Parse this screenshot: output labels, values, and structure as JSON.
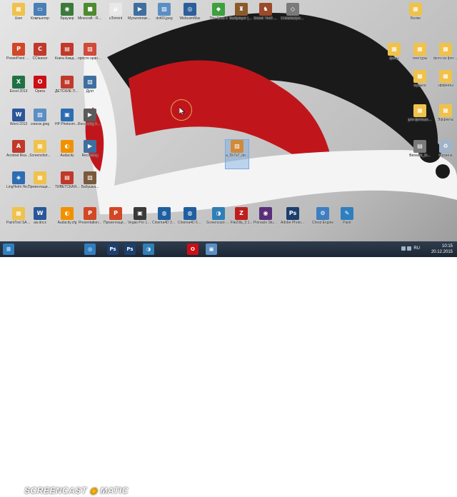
{
  "desktop": {
    "icons": [
      {
        "label": "User",
        "icon": "user-folder-icon",
        "color": "#f0c24b",
        "glyph": "▦"
      },
      {
        "label": "Компьютер",
        "icon": "computer-icon",
        "color": "#4a7fb5",
        "glyph": "▭"
      },
      {
        "label": "Браузер",
        "icon": "browser-icon",
        "color": "#3b7a3b",
        "glyph": "◉"
      },
      {
        "label": "Minecraft - Ru-M.org",
        "icon": "minecraft-icon",
        "color": "#4e8a2f",
        "glyph": "■"
      },
      {
        "label": "uTorrent",
        "icon": "utorrent-icon",
        "color": "#e8e8e8",
        "glyph": "µ"
      },
      {
        "label": "Мультипликация...",
        "icon": "video-file-icon",
        "color": "#3f6fa0",
        "glyph": "▶"
      },
      {
        "label": "dot69.jpeg",
        "icon": "image-file-icon",
        "color": "#5b8fc4",
        "glyph": "▨"
      },
      {
        "label": "WebcamMax",
        "icon": "webcam-icon",
        "color": "#2d5f9a",
        "glyph": "◎"
      },
      {
        "label": "The Sims 4",
        "icon": "sims-icon",
        "color": "#3ea03e",
        "glyph": "◆"
      },
      {
        "label": "Multiplayer [0.3e]",
        "icon": "game-icon",
        "color": "#8b5a2b",
        "glyph": "♜"
      },
      {
        "label": "Grand Theft Auto San ...",
        "icon": "gta-icon",
        "color": "#9a4a2a",
        "glyph": "♞"
      },
      {
        "label": "CristaliaUpdater.exe",
        "icon": "exe-icon",
        "color": "#7a7a7a",
        "glyph": "◇"
      },
      {
        "label": "PowerPoint 2013",
        "icon": "powerpoint-icon",
        "color": "#d24726",
        "glyph": "P"
      },
      {
        "label": "CCleaner",
        "icon": "ccleaner-icon",
        "color": "#c0392b",
        "glyph": "C"
      },
      {
        "label": "Книга Каждый ж...",
        "icon": "pdf-file-icon",
        "color": "#c0392b",
        "glyph": "▤"
      },
      {
        "label": "просто хранится_...",
        "icon": "image-file-icon",
        "color": "#d04a3a",
        "glyph": "▨"
      },
      {
        "label": "Excel 2013",
        "icon": "excel-icon",
        "color": "#1f7244",
        "glyph": "X"
      },
      {
        "label": "Opera",
        "icon": "opera-icon",
        "color": "#cc0f16",
        "glyph": "O"
      },
      {
        "label": "ДЕТСКИЕ ЛИТЕРАТ...",
        "icon": "document-icon",
        "color": "#c0392b",
        "glyph": "▤"
      },
      {
        "label": "Дуэт",
        "icon": "image-file-icon",
        "color": "#3f6fa0",
        "glyph": "▨"
      },
      {
        "label": "Word 2013",
        "icon": "word-icon",
        "color": "#2b579a",
        "glyph": "W"
      },
      {
        "label": "список.jpeg",
        "icon": "image-file-icon",
        "color": "#5b8fc4",
        "glyph": "▨"
      },
      {
        "label": "HP Photosma...",
        "icon": "hp-photosmart-icon",
        "color": "#2d6db3",
        "glyph": "▣"
      },
      {
        "label": "Recording #21.mp4",
        "icon": "video-file-icon",
        "color": "#5a5a5a",
        "glyph": "▶"
      },
      {
        "label": "Acrobat Reader DC",
        "icon": "acrobat-icon",
        "color": "#c0392b",
        "glyph": "A"
      },
      {
        "label": "Screenshot...",
        "icon": "folder-icon",
        "color": "#f0c24b",
        "glyph": "▦"
      },
      {
        "label": "Audacity",
        "icon": "audacity-icon",
        "color": "#f29100",
        "glyph": "◐"
      },
      {
        "label": "Recording",
        "icon": "video-file-icon",
        "color": "#3f6fa0",
        "glyph": "▶"
      },
      {
        "label": "LingHelm Heriachi",
        "icon": "app-icon",
        "color": "#2d6db3",
        "glyph": "◈"
      },
      {
        "label": "Презентации...",
        "icon": "folder-icon",
        "color": "#f0c24b",
        "glyph": "▦"
      },
      {
        "label": "ТИВЕТСКАЯ...",
        "icon": "document-icon",
        "color": "#c0392b",
        "glyph": "▤"
      },
      {
        "label": "Бабушка...",
        "icon": "image-file-icon",
        "color": "#7a5a3a",
        "glyph": "▨"
      },
      {
        "label": "PaintTool SAI Ru-san Pack",
        "icon": "painttool-icon",
        "color": "#f0c24b",
        "glyph": "▦"
      },
      {
        "label": "aw.docx",
        "icon": "word-doc-icon",
        "color": "#2b579a",
        "glyph": "W"
      },
      {
        "label": "Audacity.cfg",
        "icon": "audacity-icon",
        "color": "#f29100",
        "glyph": "◐"
      },
      {
        "label": "Presentation...",
        "icon": "powerpoint-doc-icon",
        "color": "#d24726",
        "glyph": "P"
      },
      {
        "label": "Презентация...",
        "icon": "powerpoint-doc-icon",
        "color": "#d24726",
        "glyph": "P"
      },
      {
        "label": "Vegas Pro 13.0 (64-bit)",
        "icon": "vegas-icon",
        "color": "#3a3a3a",
        "glyph": "▣"
      },
      {
        "label": "Cinema4D 32bit",
        "icon": "cinema4d-icon",
        "color": "#1f5fa0",
        "glyph": "◍"
      },
      {
        "label": "Cinema4D 64bit",
        "icon": "cinema4d-icon",
        "color": "#1f5fa0",
        "glyph": "◍"
      },
      {
        "label": "Screencast-O-Matic 2",
        "icon": "screencast-icon",
        "color": "#2f7fb8",
        "glyph": "◑"
      },
      {
        "label": "FileZilla_3.1...",
        "icon": "filezilla-icon",
        "color": "#bf1e1e",
        "glyph": "Z"
      },
      {
        "label": "Pinnacle Studio 16",
        "icon": "pinnacle-icon",
        "color": "#5a2f7a",
        "glyph": "◉"
      },
      {
        "label": "Adobe Photosh...",
        "icon": "photoshop-icon",
        "color": "#1b3f6e",
        "glyph": "Ps"
      },
      {
        "label": "Cheat Engine",
        "icon": "cheat-engine-icon",
        "color": "#3f7fc0",
        "glyph": "⚙"
      },
      {
        "label": "Paint",
        "icon": "paint-icon",
        "color": "#2f7fc0",
        "glyph": "✎"
      },
      {
        "label": "a_5b7a7_de...",
        "icon": "image-file-icon",
        "color": "#d08a3a",
        "glyph": "▨"
      },
      {
        "label": "Белки",
        "icon": "folder-icon",
        "color": "#f0c24b",
        "glyph": "▦"
      },
      {
        "label": "фоны",
        "icon": "folder-icon",
        "color": "#f0c24b",
        "glyph": "▦"
      },
      {
        "label": "текстуры",
        "icon": "folder-icon",
        "color": "#f0c24b",
        "glyph": "▦"
      },
      {
        "label": "фото из фотошопа",
        "icon": "folder-icon",
        "color": "#f0c24b",
        "glyph": "▦"
      },
      {
        "label": "музыка",
        "icon": "folder-icon",
        "color": "#f0c24b",
        "glyph": "▦"
      },
      {
        "label": "эффекты",
        "icon": "folder-icon",
        "color": "#f0c24b",
        "glyph": "▦"
      },
      {
        "label": "для фотошопа2",
        "icon": "folder-icon",
        "color": "#f0c24b",
        "glyph": "▦"
      },
      {
        "label": "Эффекты",
        "icon": "folder-icon",
        "color": "#f0c24b",
        "glyph": "▦"
      },
      {
        "label": "Benseth_th...",
        "icon": "document-icon",
        "color": "#7a7a7a",
        "glyph": "▤"
      },
      {
        "label": "Корзина",
        "icon": "recycle-bin-icon",
        "color": "#9fb3c9",
        "glyph": "♻"
      }
    ]
  },
  "watermark": {
    "left": "SCREENCAST",
    "sep": "◉",
    "right": "MATIC"
  },
  "taskbar": {
    "pins": [
      {
        "name": "start-icon",
        "color": "#2f7fc0",
        "glyph": "⊞"
      },
      {
        "name": "chrome-icon",
        "color": "#2f7fc0",
        "glyph": "◎"
      },
      {
        "name": "photoshop-icon",
        "color": "#1b3f6e",
        "glyph": "Ps"
      },
      {
        "name": "photoshop-icon",
        "color": "#1b3f6e",
        "glyph": "Ps"
      },
      {
        "name": "screencast-icon",
        "color": "#2f7fb8",
        "glyph": "◑"
      },
      {
        "name": "opera-icon",
        "color": "#cc0f16",
        "glyph": "O"
      },
      {
        "name": "files-icon",
        "color": "#5b8fc4",
        "glyph": "▣"
      }
    ],
    "lang": "RU",
    "time": "10:15",
    "date": "20.12.2015"
  }
}
